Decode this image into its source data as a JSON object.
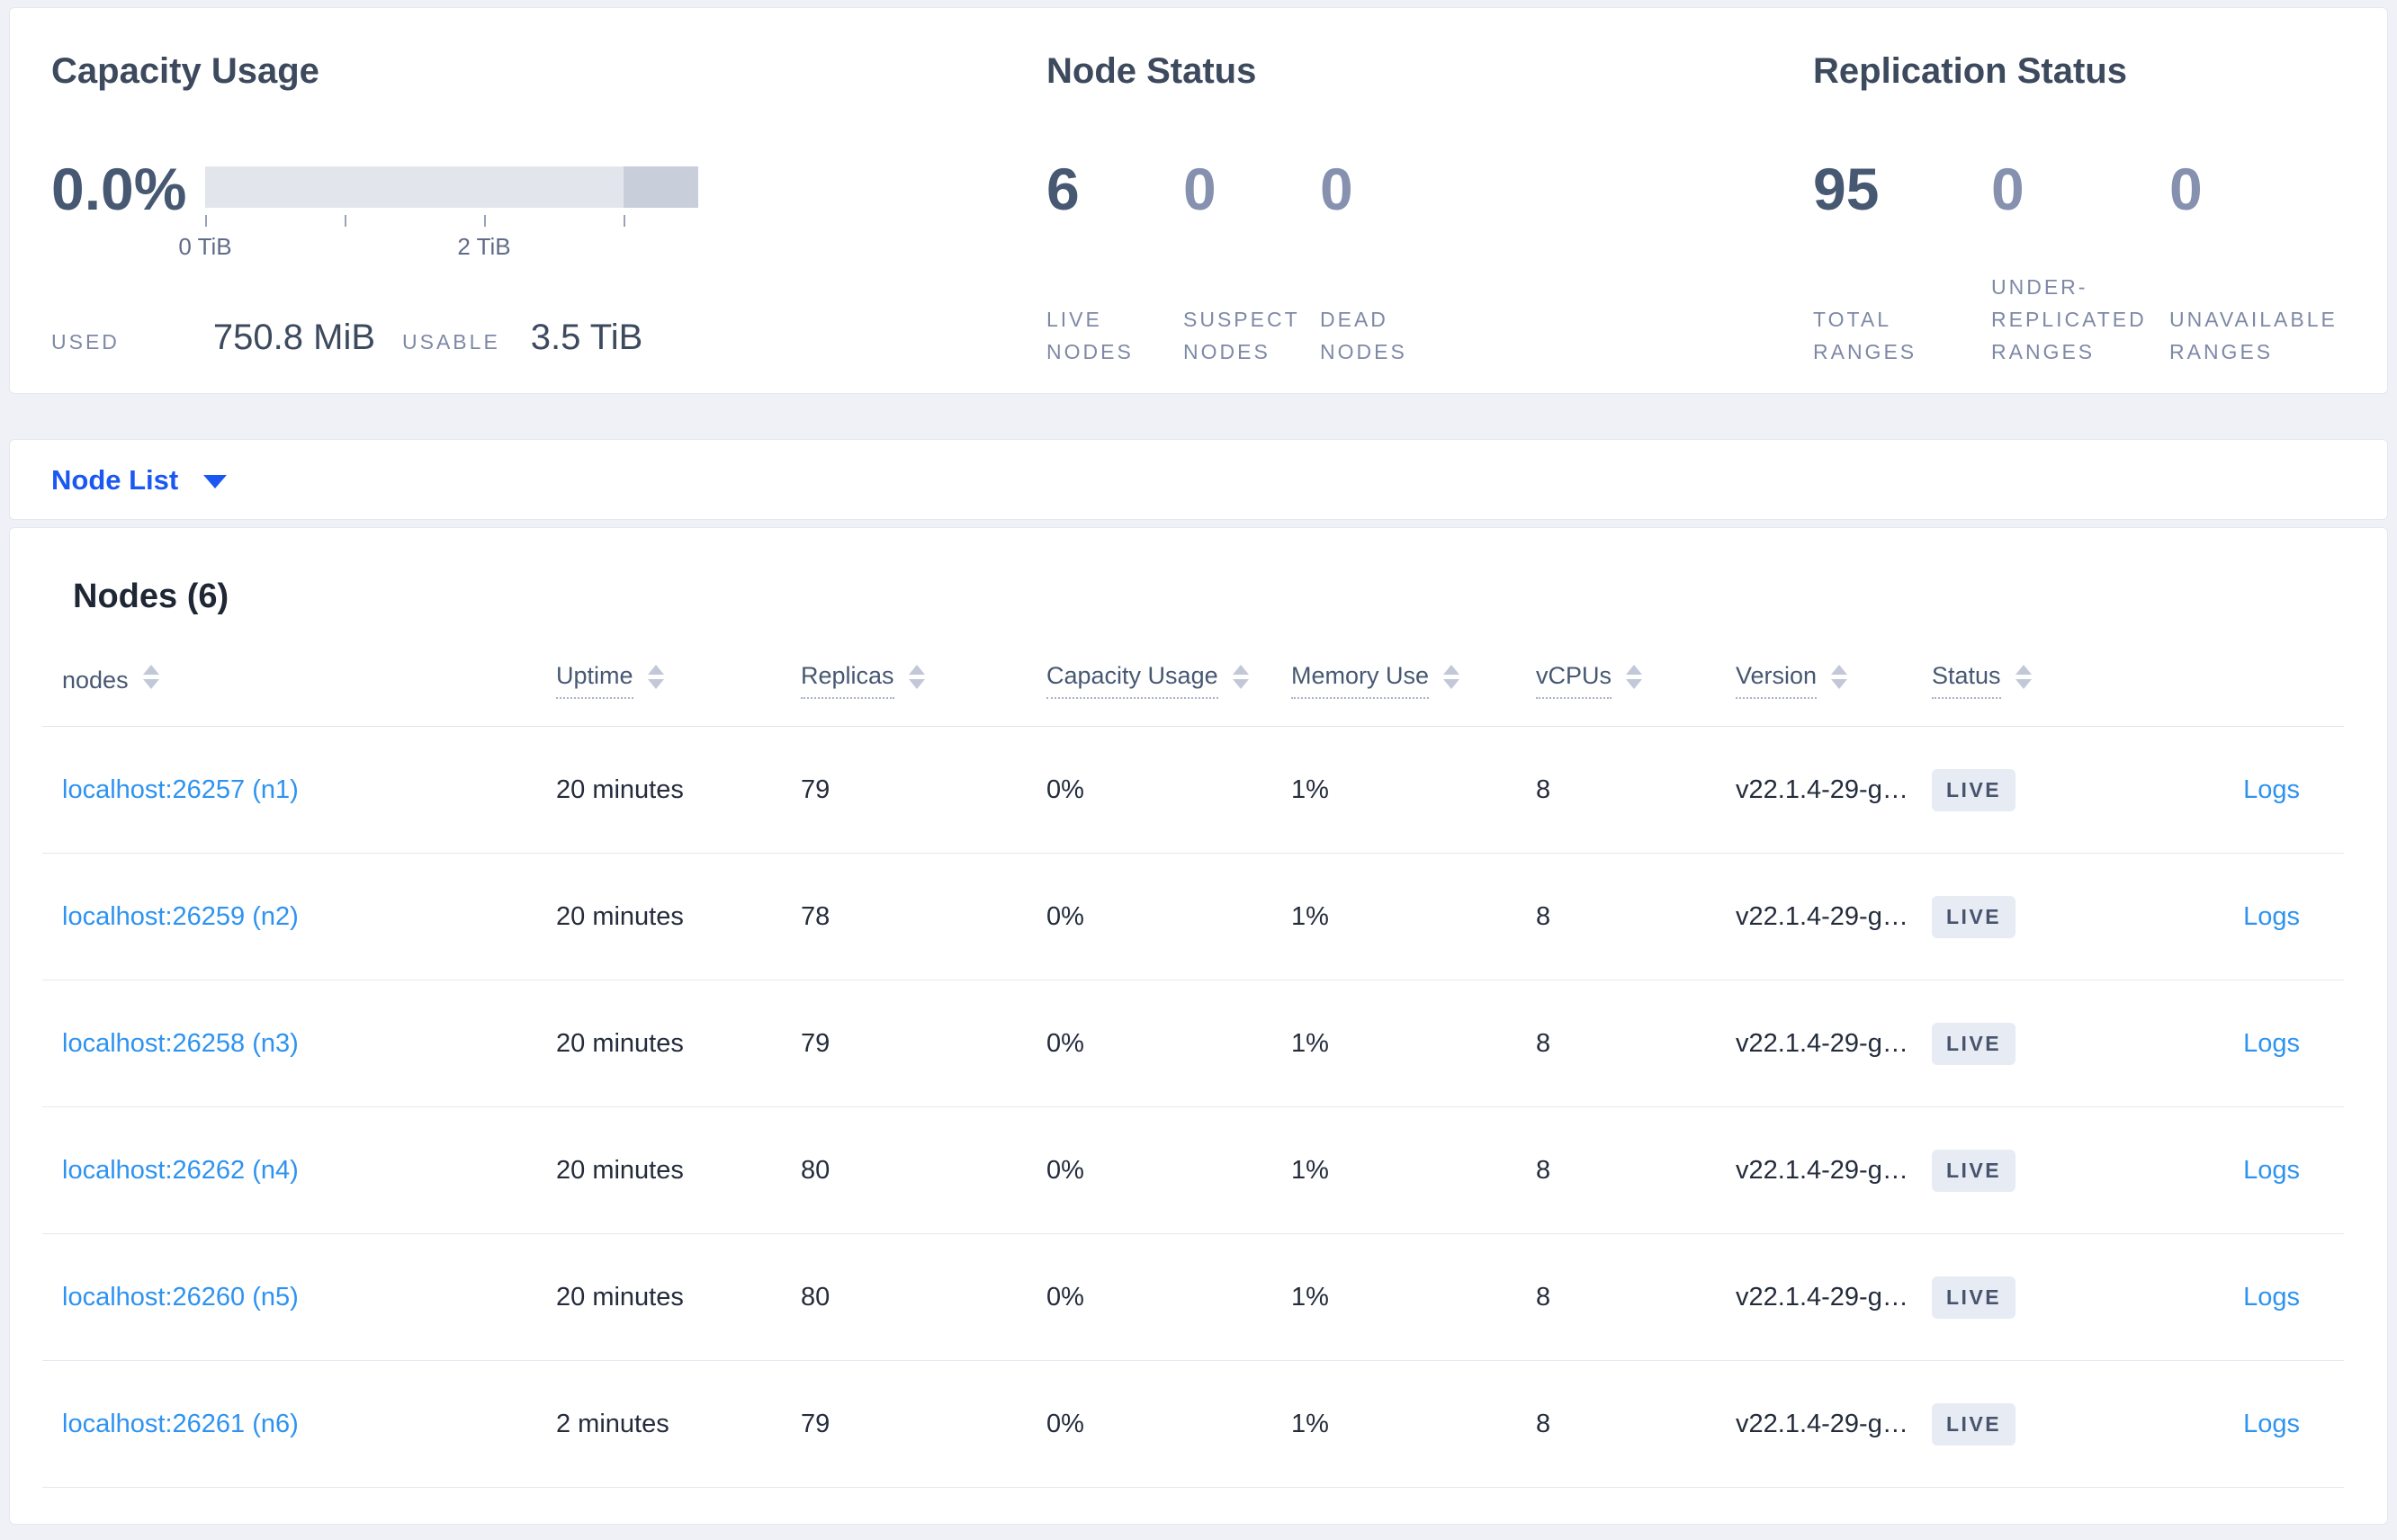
{
  "colors": {
    "page_background": "#eff1f6",
    "card_background": "#ffffff",
    "title_text": "#3d4a5e",
    "stat_number": "#475872",
    "stat_number_muted": "#8591af",
    "stat_label": "#7e89a6",
    "dropdown_blue": "#1b57f2",
    "link_blue": "#2e93f0",
    "bar_light": "#e2e5ec",
    "bar_dark": "#c9cedb",
    "badge_background": "#e7ebf3",
    "row_divider": "#e4e8f0"
  },
  "summary": {
    "capacity": {
      "title": "Capacity Usage",
      "percent": "0.0%",
      "tick_labels": [
        "0 TiB",
        "2 TiB"
      ],
      "used_label": "USED",
      "used_value": "750.8 MiB",
      "usable_label": "USABLE",
      "usable_value": "3.5 TiB"
    },
    "node_status": {
      "title": "Node Status",
      "stats": [
        {
          "value": "6",
          "label": "LIVE NODES"
        },
        {
          "value": "0",
          "label": "SUSPECT NODES"
        },
        {
          "value": "0",
          "label": "DEAD NODES"
        }
      ]
    },
    "replication": {
      "title": "Replication Status",
      "stats": [
        {
          "value": "95",
          "label": "TOTAL RANGES"
        },
        {
          "value": "0",
          "label": "UNDER-REPLICATED RANGES"
        },
        {
          "value": "0",
          "label": "UNAVAILABLE RANGES"
        }
      ]
    }
  },
  "node_list": {
    "label": "Node List"
  },
  "nodes_table": {
    "heading": "Nodes (6)",
    "columns": [
      "nodes",
      "Uptime",
      "Replicas",
      "Capacity Usage",
      "Memory Use",
      "vCPUs",
      "Version",
      "Status"
    ],
    "rows": [
      {
        "address": "localhost:26257 (n1)",
        "uptime": "20 minutes",
        "replicas": "79",
        "capacity_usage": "0%",
        "memory_use": "1%",
        "vcpus": "8",
        "version": "v22.1.4-29-g…",
        "status": "LIVE",
        "logs": "Logs"
      },
      {
        "address": "localhost:26259 (n2)",
        "uptime": "20 minutes",
        "replicas": "78",
        "capacity_usage": "0%",
        "memory_use": "1%",
        "vcpus": "8",
        "version": "v22.1.4-29-g…",
        "status": "LIVE",
        "logs": "Logs"
      },
      {
        "address": "localhost:26258 (n3)",
        "uptime": "20 minutes",
        "replicas": "79",
        "capacity_usage": "0%",
        "memory_use": "1%",
        "vcpus": "8",
        "version": "v22.1.4-29-g…",
        "status": "LIVE",
        "logs": "Logs"
      },
      {
        "address": "localhost:26262 (n4)",
        "uptime": "20 minutes",
        "replicas": "80",
        "capacity_usage": "0%",
        "memory_use": "1%",
        "vcpus": "8",
        "version": "v22.1.4-29-g…",
        "status": "LIVE",
        "logs": "Logs"
      },
      {
        "address": "localhost:26260 (n5)",
        "uptime": "20 minutes",
        "replicas": "80",
        "capacity_usage": "0%",
        "memory_use": "1%",
        "vcpus": "8",
        "version": "v22.1.4-29-g…",
        "status": "LIVE",
        "logs": "Logs"
      },
      {
        "address": "localhost:26261 (n6)",
        "uptime": "2 minutes",
        "replicas": "79",
        "capacity_usage": "0%",
        "memory_use": "1%",
        "vcpus": "8",
        "version": "v22.1.4-29-g…",
        "status": "LIVE",
        "logs": "Logs"
      }
    ]
  }
}
